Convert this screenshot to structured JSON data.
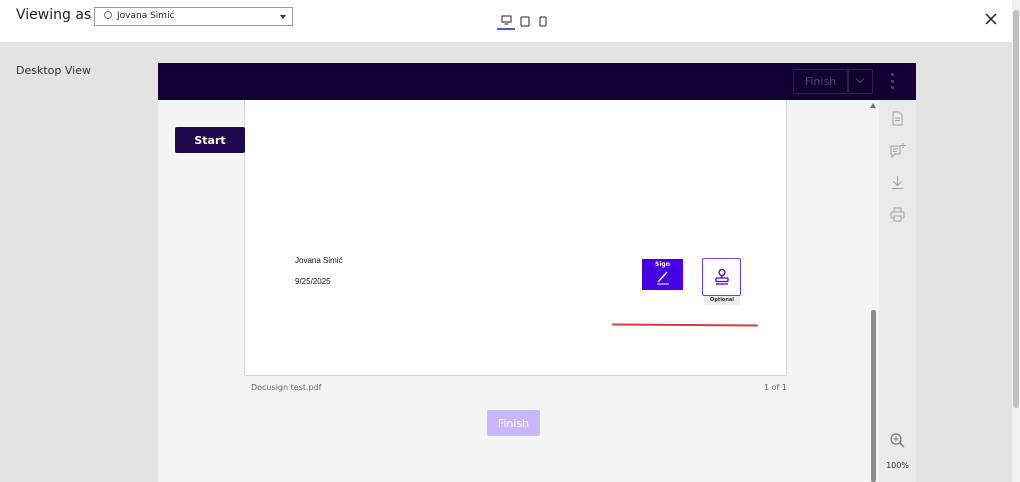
{
  "topbar": {
    "viewing_as_label": "Viewing as",
    "recipient_name": "Jovana Simić",
    "view_modes": [
      "desktop",
      "tablet",
      "mobile"
    ],
    "active_view_mode": "desktop"
  },
  "preview": {
    "view_label": "Desktop View"
  },
  "app": {
    "header": {
      "finish_label": "Finish"
    },
    "start_label": "Start",
    "document": {
      "signer_name": "Jovana Simić",
      "date": "9/25/2025",
      "sign_tag_label": "Sign",
      "optional_label": "Optional",
      "file_name": "Docusign test.pdf",
      "page_count": "1 of 1"
    },
    "finish_bottom_label": "Finish",
    "zoom": "100%"
  },
  "icons": {
    "tools": [
      "document-icon",
      "add-comment-icon",
      "download-icon",
      "print-icon",
      "zoom-in-icon"
    ]
  },
  "colors": {
    "header_bg": "#130032",
    "start_bg": "#1f0a4f",
    "sign_tag_bg": "#4700e6",
    "finish_disabled": "#c9b7fb",
    "accent_line": "#d83a3a"
  }
}
